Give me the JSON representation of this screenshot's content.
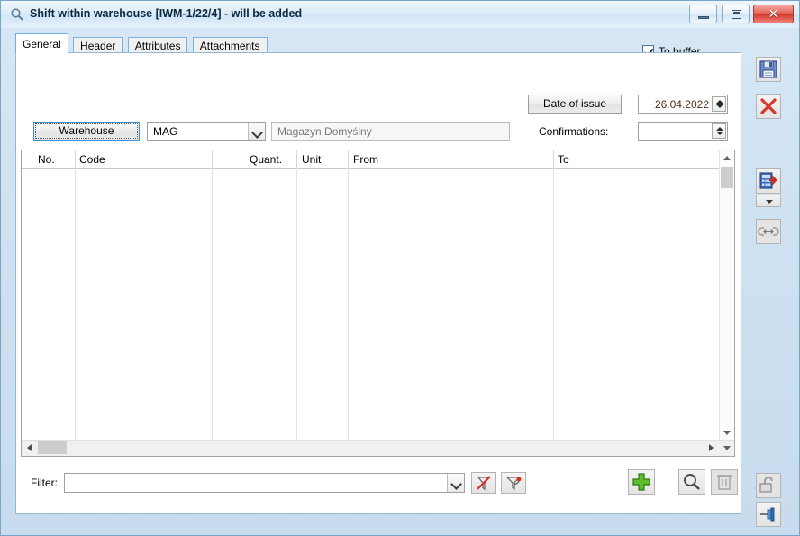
{
  "window": {
    "title": "Shift within warehouse [IWM-1/22/4]  - will be added",
    "icon": "magnifier-icon",
    "caption_buttons": {
      "minimize": "minimize-icon",
      "maximize": "maximize-icon",
      "close": "✕"
    }
  },
  "tabs": [
    {
      "label": "General",
      "active": true
    },
    {
      "label": "Header",
      "active": false
    },
    {
      "label": "Attributes",
      "active": false
    },
    {
      "label": "Attachments",
      "active": false
    }
  ],
  "form": {
    "to_buffer": {
      "label_before": "To ",
      "accel": "b",
      "label_after": "uffer",
      "checked": true
    },
    "date_of_issue": {
      "button_label": "Date of issue",
      "value": "26.04.2022"
    },
    "confirmations": {
      "label": "Confirmations:",
      "value": ""
    },
    "warehouse": {
      "button_label": "Warehouse",
      "code": "MAG",
      "name": "Magazyn Domyślny"
    }
  },
  "grid": {
    "columns": [
      {
        "key": "no",
        "label": "No."
      },
      {
        "key": "code",
        "label": "Code"
      },
      {
        "key": "quant",
        "label": "Quant."
      },
      {
        "key": "unit",
        "label": "Unit"
      },
      {
        "key": "from",
        "label": "From"
      },
      {
        "key": "to",
        "label": "To"
      }
    ],
    "rows": []
  },
  "filter_bar": {
    "label": "Filter:",
    "value": "",
    "clear_icon": "clear-filter-icon",
    "build_icon": "filter-wizard-icon",
    "add_icon": "plus-icon",
    "search_icon": "magnifier-icon",
    "delete_icon": "trash-icon"
  },
  "toolbar": {
    "save": "save-icon",
    "cancel": "close-x-icon",
    "calculate": "calculator-export-icon",
    "calculate_menu": "chevron-down-icon",
    "link": "link-icon",
    "unlock": "padlock-open-icon",
    "pin": "pin-icon"
  },
  "colors": {
    "window_frame": "#cfe2f2",
    "tab_border": "#7cb3dd",
    "date_text": "#5c2a15",
    "accent_green": "#4fa32a",
    "accent_red": "#d5372c",
    "panel_bg": "#ffffff"
  }
}
